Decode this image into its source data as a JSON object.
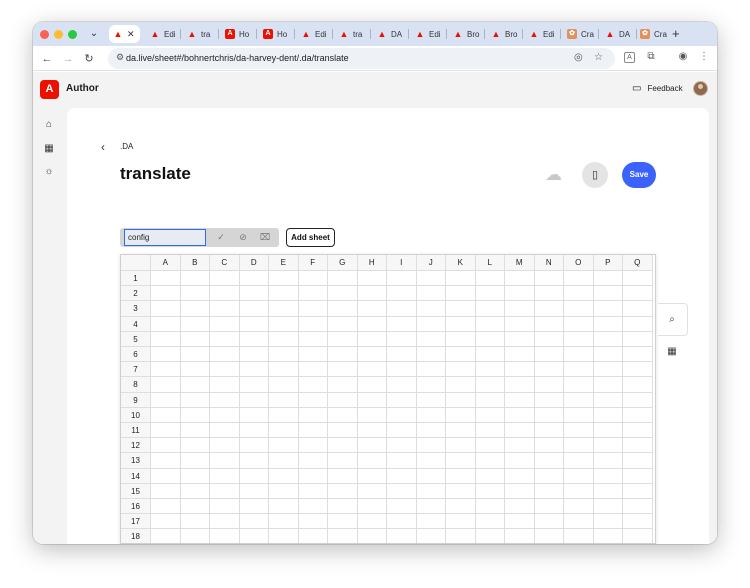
{
  "browser": {
    "tabs": [
      {
        "label": "",
        "favicon": "adobe",
        "active": true
      },
      {
        "label": "Edi",
        "favicon": "adobe"
      },
      {
        "label": "tra",
        "favicon": "adobe"
      },
      {
        "label": "Ho",
        "favicon": "adobe-red"
      },
      {
        "label": "Ho",
        "favicon": "adobe-red"
      },
      {
        "label": "Edi",
        "favicon": "adobe"
      },
      {
        "label": "tra",
        "favicon": "adobe"
      },
      {
        "label": "DA",
        "favicon": "adobe"
      },
      {
        "label": "Edi",
        "favicon": "adobe"
      },
      {
        "label": "Bro",
        "favicon": "adobe"
      },
      {
        "label": "Bro",
        "favicon": "adobe"
      },
      {
        "label": "Edi",
        "favicon": "adobe"
      },
      {
        "label": "Cra",
        "favicon": "orange"
      },
      {
        "label": "DA",
        "favicon": "adobe"
      },
      {
        "label": "Cra",
        "favicon": "orange"
      }
    ],
    "url": "da.live/sheet#/bohnertchris/da-harvey-dent/.da/translate",
    "new_tab": "+",
    "tab_close": "✕"
  },
  "app": {
    "title": "Author",
    "logo_glyph": "A",
    "feedback_label": "Feedback",
    "breadcrumb": ".DA",
    "page_title": "translate",
    "save_label": "Save",
    "sheet": {
      "name_value": "config",
      "add_sheet_label": "Add sheet",
      "columns": [
        "A",
        "B",
        "C",
        "D",
        "E",
        "F",
        "G",
        "H",
        "I",
        "J",
        "K",
        "L",
        "M",
        "N",
        "O",
        "P",
        "Q"
      ],
      "rows": [
        "1",
        "2",
        "3",
        "4",
        "5",
        "6",
        "7",
        "8",
        "9",
        "10",
        "11",
        "12",
        "13",
        "14",
        "15",
        "16",
        "17",
        "18"
      ]
    }
  },
  "icons": {
    "back": "‹",
    "forward": "›",
    "reload": "↻",
    "home": "⌂",
    "apps": "▦",
    "bulb": "☼",
    "cloud": "☁",
    "document": "▯",
    "check": "✓",
    "cancel": "⊘",
    "trash": "🗑",
    "chat": "▭",
    "search_panel": "⌕",
    "calendar": "▦"
  }
}
